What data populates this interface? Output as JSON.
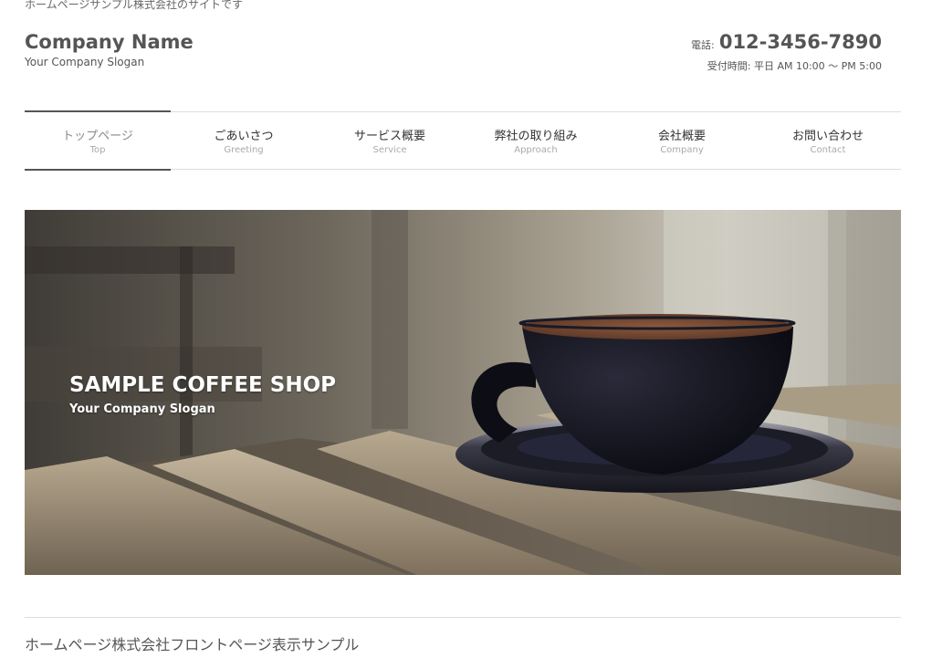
{
  "site_description": "ホームページサンプル株式会社のサイトです",
  "header": {
    "company_name": "Company Name",
    "company_slogan": "Your Company Slogan",
    "tel_label": "電話:",
    "tel_number": "012-3456-7890",
    "hours": "受付時間: 平日 AM 10:00 〜 PM 5:00"
  },
  "nav": {
    "items": [
      {
        "label": "トップページ",
        "sub": "Top",
        "current": true
      },
      {
        "label": "ごあいさつ",
        "sub": "Greeting"
      },
      {
        "label": "サービス概要",
        "sub": "Service"
      },
      {
        "label": "弊社の取り組み",
        "sub": "Approach"
      },
      {
        "label": "会社概要",
        "sub": "Company"
      },
      {
        "label": "お問い合わせ",
        "sub": "Contact"
      }
    ]
  },
  "hero": {
    "title": "SAMPLE COFFEE SHOP",
    "slogan": "Your Company Slogan"
  },
  "main": {
    "section_title": "ホームページ株式会社フロントページ表示サンプル"
  }
}
